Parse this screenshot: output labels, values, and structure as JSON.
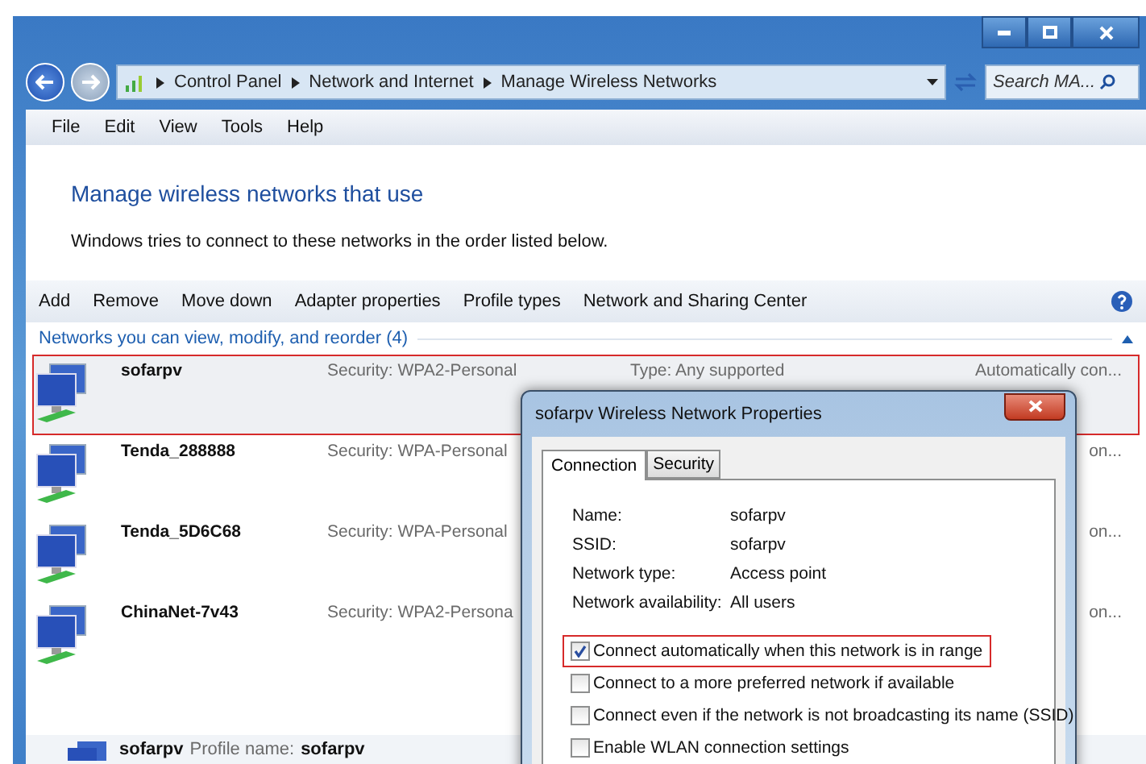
{
  "address_bar": {
    "breadcrumbs": [
      "Control Panel",
      "Network and Internet",
      "Manage Wireless Networks"
    ],
    "search_placeholder": "Search MA..."
  },
  "menu": [
    "File",
    "Edit",
    "View",
    "Tools",
    "Help"
  ],
  "heading": "Manage wireless networks that use",
  "description": "Windows tries to connect to these networks in the order listed below.",
  "toolbar": [
    "Add",
    "Remove",
    "Move down",
    "Adapter properties",
    "Profile types",
    "Network and Sharing Center"
  ],
  "group": {
    "title": "Networks you can view, modify, and reorder (4)",
    "expanded": true
  },
  "networks": [
    {
      "name": "sofarpv",
      "security": "Security: WPA2-Personal",
      "type": "Type: Any supported",
      "mode": "Automatically con...",
      "highlighted": true
    },
    {
      "name": "Tenda_288888",
      "security": "Security: WPA-Personal",
      "mode": "on...",
      "highlighted": false
    },
    {
      "name": "Tenda_5D6C68",
      "security": "Security: WPA-Personal",
      "mode": "on...",
      "highlighted": false
    },
    {
      "name": "ChinaNet-7v43",
      "security": "Security: WPA2-Persona",
      "mode": "on...",
      "highlighted": false
    }
  ],
  "details": {
    "name": "sofarpv",
    "profile_label": "Profile name:",
    "profile_value": "sofarpv"
  },
  "dialog": {
    "title": "sofarpv Wireless Network Properties",
    "tabs": [
      {
        "label": "Connection",
        "selected": true
      },
      {
        "label": "Security",
        "selected": false
      }
    ],
    "fields": [
      {
        "label": "Name:",
        "value": "sofarpv"
      },
      {
        "label": "SSID:",
        "value": "sofarpv"
      },
      {
        "label": "Network type:",
        "value": "Access point"
      },
      {
        "label": "Network availability:",
        "value": "All users"
      }
    ],
    "options": [
      {
        "label": "Connect automatically when this network is in range",
        "checked": true,
        "highlighted": true
      },
      {
        "label": "Connect to a more preferred network if available",
        "checked": false,
        "highlighted": false
      },
      {
        "label": "Connect even if the network is not broadcasting its name (SSID)",
        "checked": false,
        "highlighted": false
      },
      {
        "label": "Enable WLAN connection settings",
        "checked": false,
        "highlighted": false
      }
    ]
  }
}
